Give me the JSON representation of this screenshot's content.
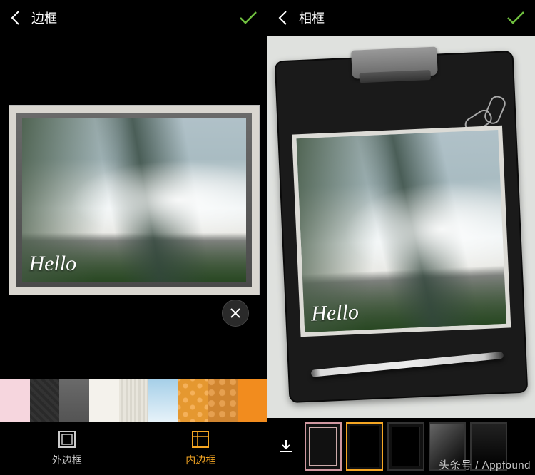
{
  "left": {
    "title": "边框",
    "photo_text": "Hello",
    "tabs": {
      "outer": "外边框",
      "inner": "内边框"
    },
    "swatches": [
      {
        "name": "pink-floral"
      },
      {
        "name": "dark-stone"
      },
      {
        "name": "gray-concrete"
      },
      {
        "name": "off-white"
      },
      {
        "name": "white-stripe"
      },
      {
        "name": "sky-blue"
      },
      {
        "name": "orange-hearts"
      },
      {
        "name": "autumn-leaves"
      },
      {
        "name": "solid-orange"
      }
    ]
  },
  "right": {
    "title": "相框",
    "photo_text": "Hello",
    "frames": [
      {
        "name": "pink-double"
      },
      {
        "name": "clipboard-black",
        "selected": true
      },
      {
        "name": "thin-black"
      },
      {
        "name": "spotlight"
      },
      {
        "name": "plain-dark"
      }
    ]
  },
  "watermark": "头条号 / Appfound"
}
